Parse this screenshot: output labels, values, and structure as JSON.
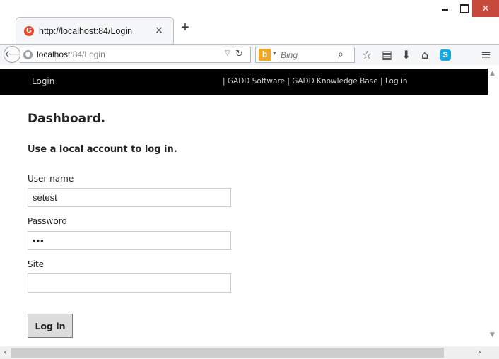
{
  "browser": {
    "tab": {
      "title": "http://localhost:84/Login",
      "favicon_letter": "G",
      "close_label": "×"
    },
    "new_tab_label": "+",
    "window_close_label": "×",
    "address": {
      "host": "localhost",
      "rest": ":84/Login"
    },
    "search": {
      "engine_letter": "b",
      "placeholder": "Bing"
    },
    "skype_letter": "S"
  },
  "site": {
    "brand": "Login",
    "nav_links": "| GADD Software | GADD Knowledge Base | Log in"
  },
  "page": {
    "title": "Dashboard.",
    "subtitle": "Use a local account to log in.",
    "form": {
      "username_label": "User name",
      "username_value": "setest",
      "password_label": "Password",
      "password_value": "•••",
      "site_label": "Site",
      "site_value": "",
      "submit_label": "Log in"
    }
  }
}
